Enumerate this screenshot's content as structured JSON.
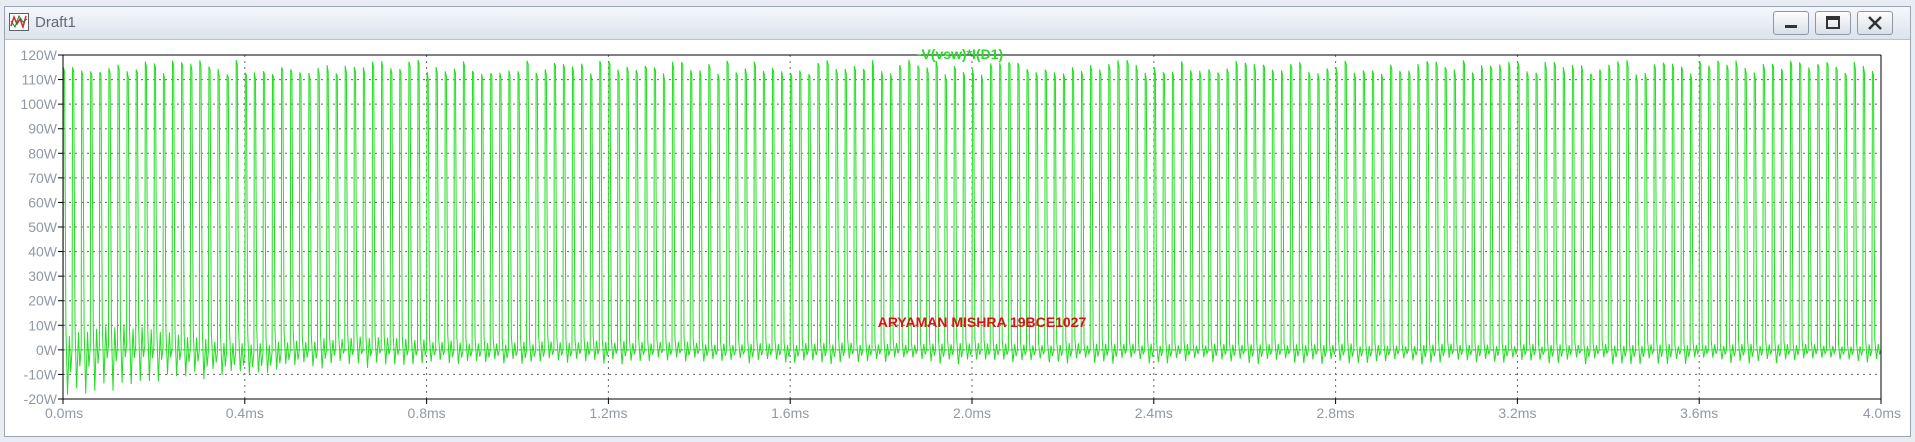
{
  "window": {
    "title": "Draft1",
    "icon": "waveform-plot-icon",
    "controls": [
      "minimize-icon",
      "maximize-icon",
      "close-icon"
    ]
  },
  "colors": {
    "trace": "#22dd22",
    "annotation": "#dd1111",
    "ticks": "#9099a5",
    "grid": "#666666",
    "axes": "#000000"
  },
  "annotation": {
    "text": "ARYAMAN MISHRA 19BCE1027"
  },
  "chart_data": {
    "type": "line",
    "title": "-V(vsw)*I(D1)",
    "xlabel": "",
    "ylabel": "",
    "xlim": [
      0,
      4.0
    ],
    "ylim": [
      -20,
      120
    ],
    "x_ticks": [
      "0.0ms",
      "0.4ms",
      "0.8ms",
      "1.2ms",
      "1.6ms",
      "2.0ms",
      "2.4ms",
      "2.8ms",
      "3.2ms",
      "3.6ms",
      "4.0ms"
    ],
    "y_ticks": [
      "120W",
      "110W",
      "100W",
      "90W",
      "80W",
      "70W",
      "60W",
      "50W",
      "40W",
      "30W",
      "20W",
      "10W",
      "0W",
      "-10W",
      "-20W"
    ],
    "grid": true,
    "series": [
      {
        "name": "-V(vsw)*I(D1)",
        "x_unit": "ms",
        "y_unit": "W",
        "pulse_count": 200,
        "pulse_period_ms": 0.02,
        "pulse_peak": 116,
        "baseline": 0,
        "envelope_min": -16,
        "envelope_max": 7
      }
    ]
  }
}
